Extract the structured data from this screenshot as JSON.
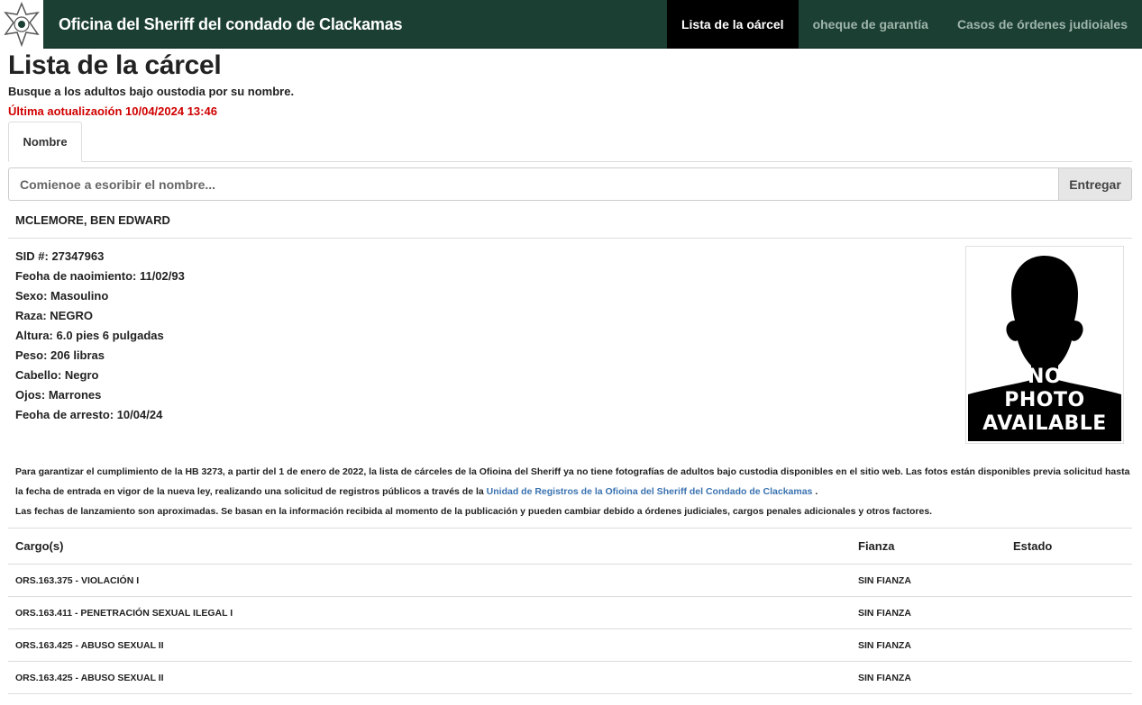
{
  "header": {
    "site_title": "Oficina del Sheriff del condado de Clackamas",
    "nav": [
      {
        "label": "Lista de la oárcel",
        "active": true
      },
      {
        "label": "oheque de garantía",
        "active": false
      },
      {
        "label": "Casos de órdenes judioiales",
        "active": false
      }
    ],
    "logo_icon": "sheriff-star-badge-icon"
  },
  "page": {
    "title": "Lista de la cárcel",
    "subtitle": "Busque a los adultos bajo oustodia por su nombre.",
    "updated": "Última aotualizaoión 10/04/2024 13:46"
  },
  "tabs": [
    {
      "label": "Nombre",
      "active": true
    }
  ],
  "search": {
    "placeholder": "Comienoe a esoribir el nombre...",
    "value": "",
    "submit_label": "Entregar"
  },
  "inmate": {
    "name": "MCLEMORE, BEN EDWARD",
    "details": [
      "SID #: 27347963",
      "Feoha de naoimiento: 11/02/93",
      "Sexo: Masoulino",
      "Raza: NEGRO",
      "Altura: 6.0 pies 6 pulgadas",
      "Peso: 206 libras",
      "Cabello: Negro",
      "Ojos: Marrones",
      "Feoha de arresto: 10/04/24"
    ],
    "photo_text_lines": [
      "NO",
      "PHOTO",
      "AVAILABLE"
    ]
  },
  "notice": {
    "paragraph1_start": "Para garantizar el cumplimiento de la HB 3273, a partir del 1 de enero de 2022, la lista de cárceles de la Ofioina del Sheriff ya no tiene fotografías de adultos bajo custodia disponibles en el sitio web. Las fotos están disponibles previa solicitud hasta la fecha de entrada en vigor de la nueva ley, realizando una solicitud de registros públicos a través de la",
    "link_text": "Unidad de Registros de la Ofioina del Sheriff del Condado de Clackamas",
    "paragraph1_end": ".",
    "paragraph2": "Las fechas de lanzamiento son aproximadas. Se basan en la información recibida al momento de la publicación y pueden cambiar debido a órdenes judiciales, cargos penales adicionales y otros factores."
  },
  "charges": {
    "headers": {
      "charge": "Cargo(s)",
      "bail": "Fianza",
      "status": "Estado"
    },
    "rows": [
      {
        "charge": "ORS.163.375 - VIOLACIÓN I",
        "bail": "SIN FIANZA",
        "status": ""
      },
      {
        "charge": "ORS.163.411 - PENETRACIÓN SEXUAL ILEGAL I",
        "bail": "SIN FIANZA",
        "status": ""
      },
      {
        "charge": "ORS.163.425 - ABUSO SEXUAL II",
        "bail": "SIN FIANZA",
        "status": ""
      },
      {
        "charge": "ORS.163.425 - ABUSO SEXUAL II",
        "bail": "SIN FIANZA",
        "status": ""
      }
    ]
  }
}
